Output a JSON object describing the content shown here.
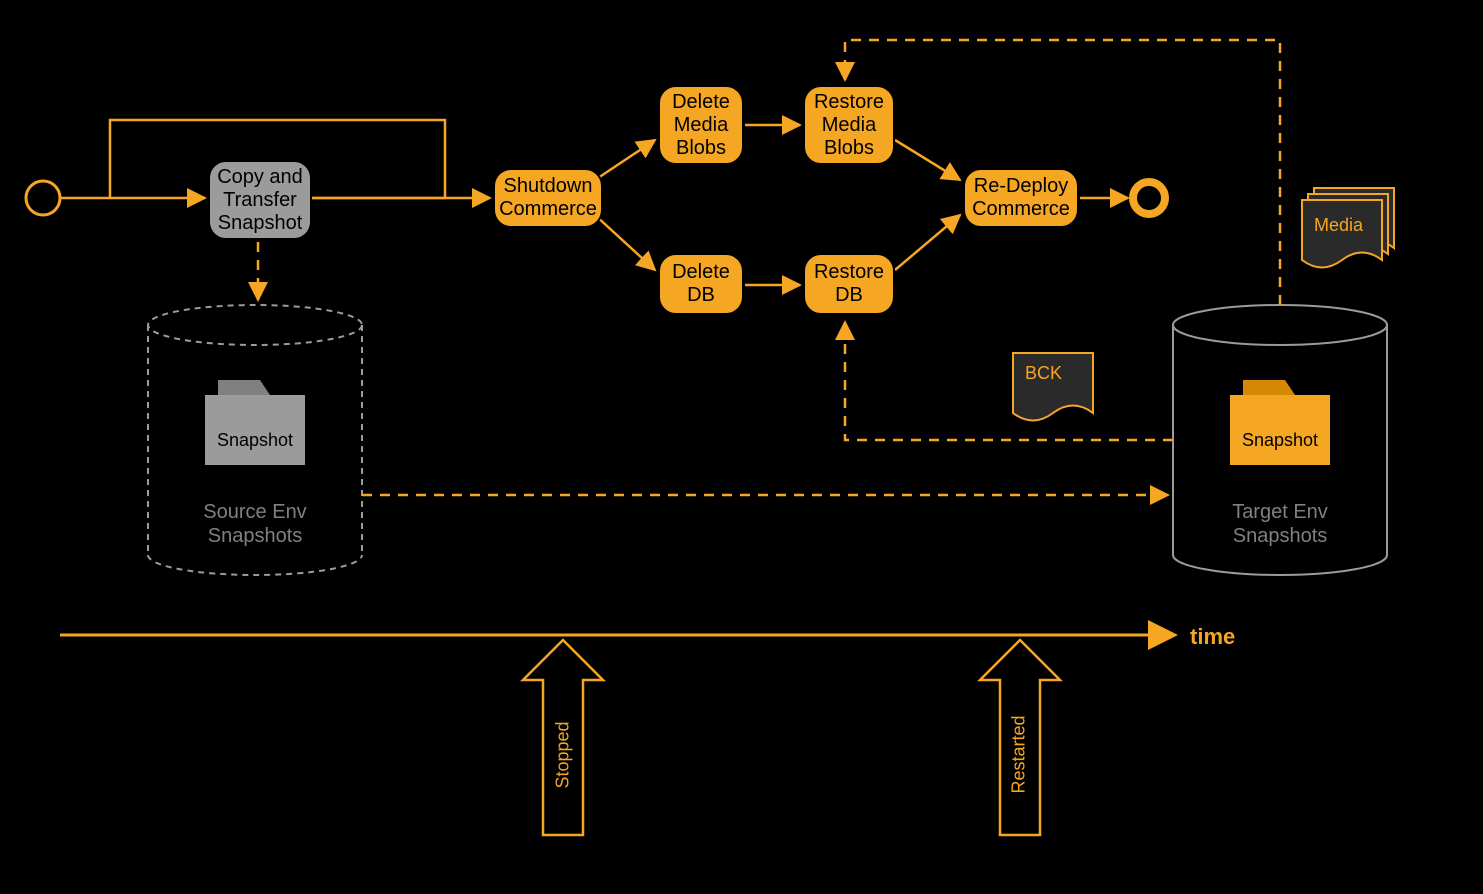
{
  "nodes": {
    "copy_transfer": "Copy and\nTransfer\nSnapshot",
    "shutdown": "Shutdown\nCommerce",
    "delete_media": "Delete\nMedia\nBlobs",
    "restore_media": "Restore\nMedia\nBlobs",
    "delete_db": "Delete\nDB",
    "restore_db": "Restore\nDB",
    "redeploy": "Re-Deploy\nCommerce"
  },
  "storage": {
    "source_folder": "Snapshot",
    "source_db": "Source Env\nSnapshots",
    "target_folder": "Snapshot",
    "target_db": "Target Env\nSnapshots"
  },
  "documents": {
    "bck": "BCK",
    "media": "Media"
  },
  "timeline": {
    "label": "time",
    "stopped": "Stopped",
    "restarted": "Restarted"
  }
}
